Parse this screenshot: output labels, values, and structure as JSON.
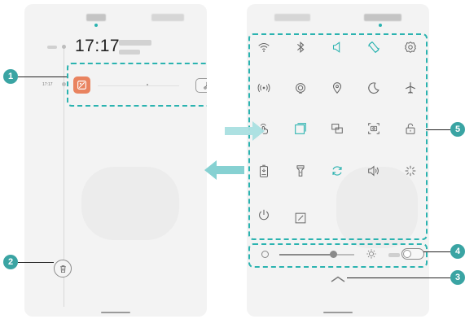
{
  "left_screen": {
    "tabs": [
      {
        "name": "notifications-tab",
        "active": true
      },
      {
        "name": "shortcuts-tab",
        "active": false
      }
    ],
    "clock_time": "17:17",
    "timeline_time": "17:17",
    "notification": {
      "app_icon": "gallery-icon",
      "action_icon": "share-icon"
    },
    "trash_icon": "trash-icon"
  },
  "right_screen": {
    "tiles": [
      {
        "icon": "wifi-icon",
        "active": false
      },
      {
        "icon": "bluetooth-icon",
        "active": false
      },
      {
        "icon": "sound-icon",
        "active": true
      },
      {
        "icon": "auto-rotate-icon",
        "active": true
      },
      {
        "icon": "settings-gear-icon",
        "active": false
      },
      {
        "icon": "mobile-data-icon",
        "active": false
      },
      {
        "icon": "hotspot-icon",
        "active": false
      },
      {
        "icon": "location-icon",
        "active": false
      },
      {
        "icon": "eye-comfort-icon",
        "active": false
      },
      {
        "icon": "airplane-mode-icon",
        "active": false
      },
      {
        "icon": "touch-icon",
        "active": false
      },
      {
        "icon": "multi-window-icon",
        "active": true
      },
      {
        "icon": "screen-cast-icon",
        "active": false
      },
      {
        "icon": "screenshot-icon",
        "active": false
      },
      {
        "icon": "screen-lock-icon",
        "active": false
      },
      {
        "icon": "power-saving-icon",
        "active": false
      },
      {
        "icon": "flashlight-icon",
        "active": false
      },
      {
        "icon": "sync-icon",
        "active": true
      },
      {
        "icon": "volume-icon",
        "active": false
      },
      {
        "icon": "performance-icon",
        "active": false
      },
      {
        "icon": "power-off-icon",
        "active": false
      },
      {
        "icon": "edit-icon",
        "active": false
      }
    ],
    "brightness": {
      "level": 0.72,
      "auto_enabled": false
    },
    "expand_icon": "chevron-up-icon"
  },
  "callouts": [
    "1",
    "2",
    "3",
    "4",
    "5"
  ],
  "colors": {
    "accent": "#2bb3b0",
    "callout": "#3aa4a3",
    "arrow": "#7fcfd0",
    "app_icon": "#e9835f"
  }
}
